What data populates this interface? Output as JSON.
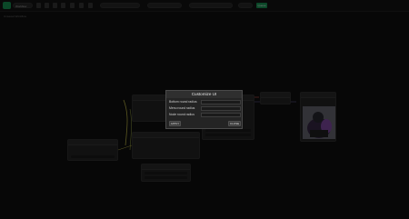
{
  "toolbar": {
    "workflow_label": "Workflow",
    "queue_label": "Queue"
  },
  "breadcrumb": "Unsaved Workflow",
  "dialog": {
    "title": "Customize UI",
    "fields": [
      {
        "label": "Bottom round radius",
        "value": ""
      },
      {
        "label": "Menu round radius",
        "value": ""
      },
      {
        "label": "Node round radius",
        "value": ""
      }
    ],
    "apply_label": "APPLY",
    "close_label": "CLOSE"
  },
  "colors": {
    "accent": "#19a05a",
    "link_yellow": "#c9c24a",
    "link_red": "#c0504d"
  }
}
